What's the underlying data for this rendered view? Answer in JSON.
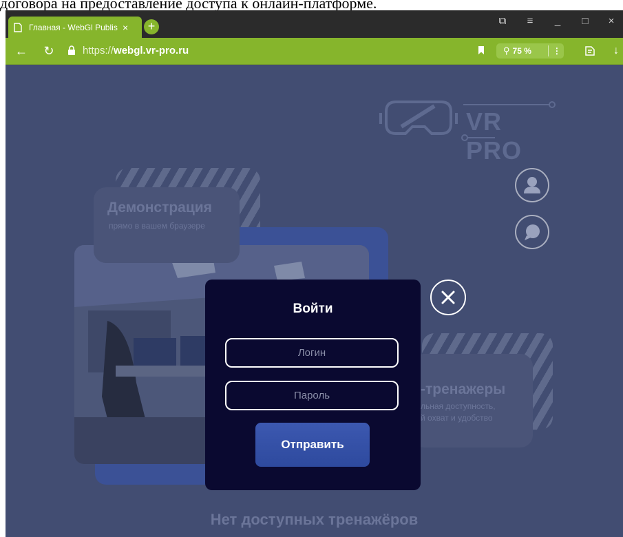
{
  "document": {
    "partial_line": "договора на предоставление доступа к онлайн-платформе."
  },
  "browser": {
    "tab": {
      "title": "Главная - WebGl Publis",
      "close_label": "×",
      "new_tab_label": "+"
    },
    "window_controls": {
      "tabs_icon": "⧉",
      "menu_icon": "≡",
      "minimize": "_",
      "maximize": "□",
      "close": "×"
    },
    "nav": {
      "back": "←",
      "reload": "↻"
    },
    "url": {
      "scheme": "https://",
      "host": "webgl.vr-pro.ru"
    },
    "zoom": {
      "icon": "⚲",
      "value": "75 %",
      "menu": "⋮"
    },
    "toolbar": {
      "reader_icon": "reader-mode-icon",
      "download_icon": "↓"
    }
  },
  "page": {
    "logo_text": "VR PRO",
    "card_left": {
      "title": "Демонстрация",
      "subtitle": "прямо в вашем браузере"
    },
    "card_right": {
      "title": "-тренажеры",
      "subtitle_line1": "льная доступность,",
      "subtitle_line2": "й охват и удобство"
    },
    "bottom_text": "Нет доступных тренажёров",
    "icons": {
      "profile": "user-icon",
      "chat": "chat-bubble-icon"
    }
  },
  "modal": {
    "title": "Войти",
    "login_placeholder": "Логин",
    "password_placeholder": "Пароль",
    "submit_label": "Отправить",
    "close_icon": "close-icon"
  },
  "colors": {
    "browser_accent": "#86b52c",
    "page_background": "#424d72",
    "modal_background": "#0a0930",
    "button_blue": "#3c58b0"
  }
}
